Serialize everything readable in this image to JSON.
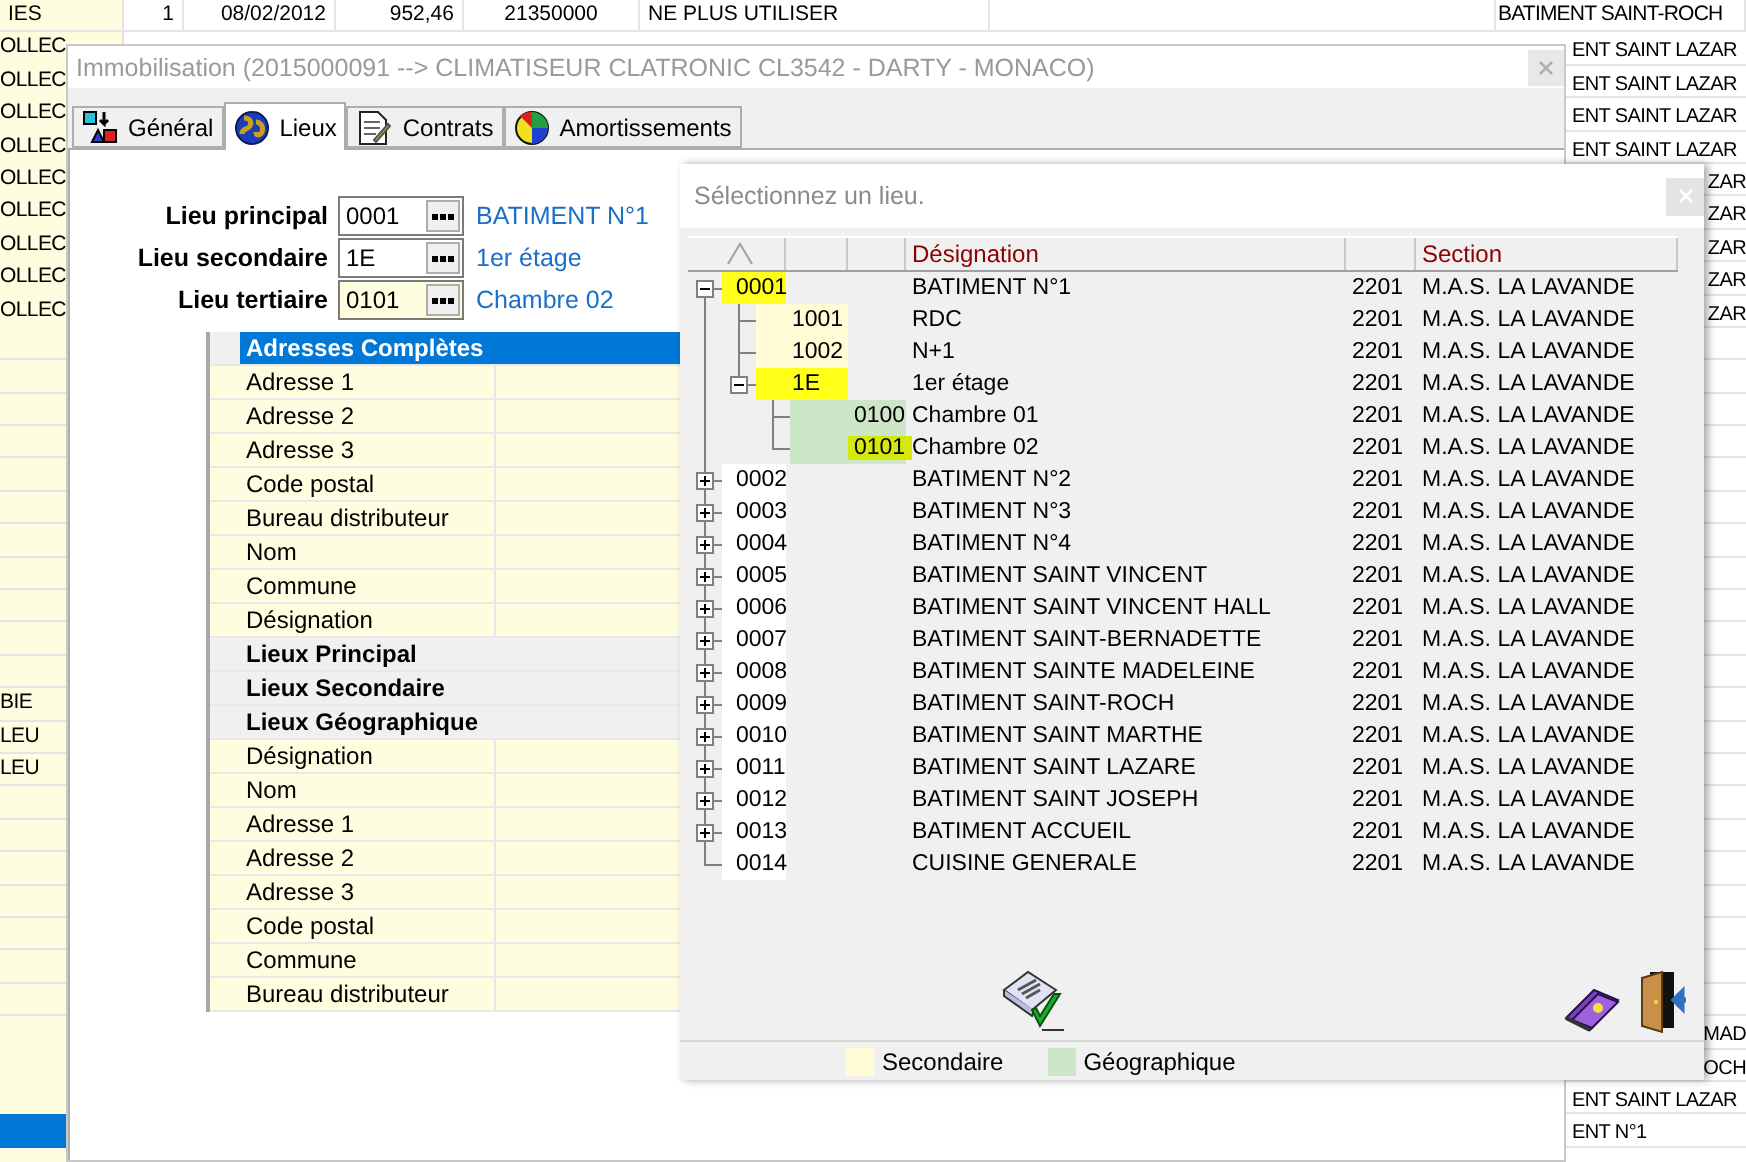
{
  "background_table": {
    "header_row": [
      "IES",
      "1",
      "08/02/2012",
      "952,46",
      "21350000",
      "NE PLUS UTILISER",
      "BATIMENT SAINT-ROCH"
    ],
    "left_column": {
      "top": [
        "OLLEC",
        "OLLEC",
        "OLLEC",
        "OLLEC",
        "OLLEC",
        "OLLEC",
        "OLLEC",
        "OLLEC",
        "OLLEC"
      ],
      "bottom": [
        "BIE",
        "LEU",
        "LEU"
      ],
      "last_row_selected": true
    },
    "right_column": {
      "upper": [
        "ENT SAINT LAZAR",
        "ENT SAINT LAZAR",
        "ENT SAINT LAZAR",
        "ENT SAINT LAZAR"
      ],
      "beside_dialog_top": [
        "ZAR",
        "ZAR",
        "ZAR",
        "ZAR",
        "ZAR"
      ],
      "beside_dialog_bottom": [
        "MAD",
        "OCH"
      ],
      "below_dialog": [
        "ENT SAINT LAZAR",
        "ENT N°1"
      ]
    }
  },
  "window": {
    "title": "Immobilisation (2015000091 --> CLIMATISEUR CLATRONIC CL3542 - DARTY - MONACO)"
  },
  "tabs": [
    {
      "label": "Général",
      "selected": false
    },
    {
      "label": "Lieux",
      "selected": true
    },
    {
      "label": "Contrats",
      "selected": false
    },
    {
      "label": "Amortissements",
      "selected": false
    }
  ],
  "fields": [
    {
      "label": "Lieu principal",
      "value": "0001",
      "description": "BATIMENT N°1",
      "active": false
    },
    {
      "label": "Lieu secondaire",
      "value": "1E",
      "description": "1er étage",
      "active": false
    },
    {
      "label": "Lieu tertiaire",
      "value": "0101",
      "description": "Chambre 02",
      "active": true
    }
  ],
  "property_grid": {
    "sections": [
      {
        "title": "Adresses Complètes",
        "selected": true,
        "rows": [
          "Adresse 1",
          "Adresse 2",
          "Adresse 3",
          "Code postal",
          "Bureau distributeur",
          "Nom",
          "Commune",
          "Désignation"
        ]
      },
      {
        "title": "Lieux Principal",
        "selected": false
      },
      {
        "title": "Lieux Secondaire",
        "selected": false
      },
      {
        "title": "Lieux Géographique",
        "selected": false,
        "rows": [
          "Désignation",
          "Nom",
          "Adresse 1",
          "Adresse 2",
          "Adresse 3",
          "Code postal",
          "Commune",
          "Bureau distributeur"
        ]
      }
    ]
  },
  "dialog": {
    "title": "Sélectionnez un lieu.",
    "columns": [
      "Désignation",
      "Section"
    ],
    "tree": [
      {
        "label": "0001",
        "designation": "BATIMENT N°1",
        "column_5": "2201",
        "section": "M.A.S. LA LAVANDE",
        "selected": true,
        "expanded": true,
        "children": [
          {
            "label": "1001",
            "designation": "RDC",
            "column_5": "2201",
            "section": "M.A.S. LA LAVANDE",
            "selected": false
          },
          {
            "label": "1002",
            "designation": "N+1",
            "column_5": "2201",
            "section": "M.A.S. LA LAVANDE",
            "selected": false
          },
          {
            "label": "1E",
            "designation": "1er étage",
            "column_5": "2201",
            "section": "M.A.S. LA LAVANDE",
            "selected": true,
            "expanded": true,
            "children": [
              {
                "label": "0100",
                "designation": "Chambre 01",
                "column_5": "2201",
                "section": "M.A.S. LA LAVANDE",
                "selected": false
              },
              {
                "label": "0101",
                "designation": "Chambre 02",
                "column_5": "2201",
                "section": "M.A.S. LA LAVANDE",
                "selected": true
              }
            ]
          }
        ]
      },
      {
        "label": "0002",
        "designation": "BATIMENT N°2",
        "column_5": "2201",
        "section": "M.A.S. LA LAVANDE",
        "selected": false,
        "expanded": false
      },
      {
        "label": "0003",
        "designation": "BATIMENT N°3",
        "column_5": "2201",
        "section": "M.A.S. LA LAVANDE",
        "selected": false,
        "expanded": false
      },
      {
        "label": "0004",
        "designation": "BATIMENT N°4",
        "column_5": "2201",
        "section": "M.A.S. LA LAVANDE",
        "selected": false,
        "expanded": false
      },
      {
        "label": "0005",
        "designation": "BATIMENT SAINT VINCENT",
        "column_5": "2201",
        "section": "M.A.S. LA LAVANDE",
        "selected": false,
        "expanded": false
      },
      {
        "label": "0006",
        "designation": "BATIMENT SAINT VINCENT HALL",
        "column_5": "2201",
        "section": "M.A.S. LA LAVANDE",
        "selected": false,
        "expanded": false
      },
      {
        "label": "0007",
        "designation": "BATIMENT SAINT-BERNADETTE",
        "column_5": "2201",
        "section": "M.A.S. LA LAVANDE",
        "selected": false,
        "expanded": false
      },
      {
        "label": "0008",
        "designation": "BATIMENT SAINTE MADELEINE",
        "column_5": "2201",
        "section": "M.A.S. LA LAVANDE",
        "selected": false,
        "expanded": false
      },
      {
        "label": "0009",
        "designation": "BATIMENT SAINT-ROCH",
        "column_5": "2201",
        "section": "M.A.S. LA LAVANDE",
        "selected": false,
        "expanded": false
      },
      {
        "label": "0010",
        "designation": "BATIMENT SAINT MARTHE",
        "column_5": "2201",
        "section": "M.A.S. LA LAVANDE",
        "selected": false,
        "expanded": false
      },
      {
        "label": "0011",
        "designation": "BATIMENT SAINT LAZARE",
        "column_5": "2201",
        "section": "M.A.S. LA LAVANDE",
        "selected": false,
        "expanded": false
      },
      {
        "label": "0012",
        "designation": "BATIMENT SAINT JOSEPH",
        "column_5": "2201",
        "section": "M.A.S. LA LAVANDE",
        "selected": false,
        "expanded": false
      },
      {
        "label": "0013",
        "designation": "BATIMENT ACCUEIL",
        "column_5": "2201",
        "section": "M.A.S. LA LAVANDE",
        "selected": false,
        "expanded": false
      },
      {
        "label": "0014",
        "designation": "CUISINE GENERALE",
        "column_5": "2201",
        "section": "M.A.S. LA LAVANDE",
        "selected": false
      }
    ],
    "legend": [
      {
        "label": "Secondaire",
        "color": "#fffcd6"
      },
      {
        "label": "Géographique",
        "color": "#cde6c8"
      }
    ]
  }
}
